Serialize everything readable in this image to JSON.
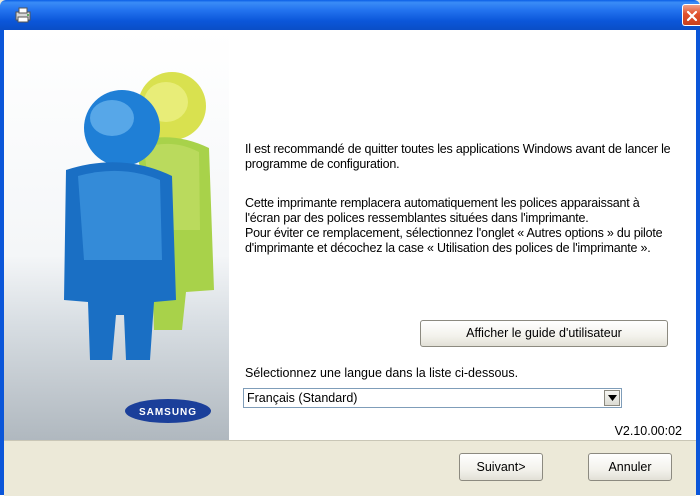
{
  "window": {
    "title": "",
    "close_icon": "close-icon",
    "app_icon": "installer-icon"
  },
  "banner": {
    "brand": "SAMSUNG",
    "colors": {
      "figure_blue": "#1f7fd6",
      "figure_yellow": "#d6e24a",
      "figure_green": "#8fc84a"
    }
  },
  "content": {
    "paragraph1": "Il est recommandé de quitter toutes les applications Windows avant de lancer le programme de configuration.",
    "paragraph2_line1": "Cette imprimante remplacera automatiquement les polices apparaissant à l'écran par des polices ressemblantes situées dans l'imprimante.",
    "paragraph2_line2": "Pour éviter ce remplacement, sélectionnez l'onglet « Autres options » du pilote d'imprimante et décochez la case « Utilisation des polices de l'imprimante ».",
    "guide_button": "Afficher le guide d'utilisateur",
    "language_label": "Sélectionnez une langue dans la liste ci-dessous.",
    "language_selected": "Français (Standard)",
    "version": "V2.10.00:02"
  },
  "footer": {
    "next_label": "Suivant>",
    "cancel_label": "Annuler"
  }
}
